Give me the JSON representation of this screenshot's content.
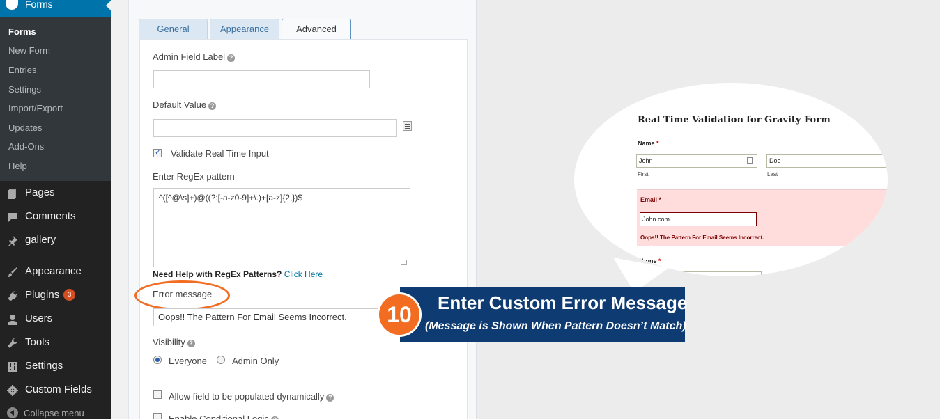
{
  "sidebar": {
    "top_label": "Forms",
    "submenu": [
      "Forms",
      "New Form",
      "Entries",
      "Settings",
      "Import/Export",
      "Updates",
      "Add-Ons",
      "Help"
    ],
    "items": [
      {
        "label": "Pages",
        "icon": "pages-icon"
      },
      {
        "label": "Comments",
        "icon": "comments-icon"
      },
      {
        "label": "gallery",
        "icon": "pin-icon"
      },
      {
        "label": "Appearance",
        "icon": "brush-icon"
      },
      {
        "label": "Plugins",
        "icon": "plugin-icon",
        "badge": "3"
      },
      {
        "label": "Users",
        "icon": "user-icon"
      },
      {
        "label": "Tools",
        "icon": "wrench-icon"
      },
      {
        "label": "Settings",
        "icon": "sliders-icon"
      },
      {
        "label": "Custom Fields",
        "icon": "gear-icon"
      }
    ],
    "collapse_label": "Collapse menu"
  },
  "tabs": [
    "General",
    "Appearance",
    "Advanced"
  ],
  "active_tab": "Advanced",
  "form": {
    "admin_label": "Admin Field Label",
    "admin_value": "",
    "default_label": "Default Value",
    "default_value": "",
    "validate_label": "Validate Real Time Input",
    "validate_checked": true,
    "regex_label": "Enter RegEx pattern",
    "regex_value": "^([^@\\s]+)@((?:[-a-z0-9]+\\.)+[a-z]{2,})$",
    "regex_help_text": "Need Help with RegEx Patterns?",
    "regex_help_link": "Click Here",
    "error_label": "Error message",
    "error_value": "Oops!! The Pattern For Email Seems Incorrect.",
    "visibility_label": "Visibility",
    "visibility_options": [
      "Everyone",
      "Admin Only"
    ],
    "visibility_selected": "Everyone",
    "allow_dynamic_label": "Allow field to be populated dynamically",
    "conditional_label": "Enable Conditional Logic"
  },
  "preview": {
    "title": "Real Time Validation for Gravity Form",
    "name_label": "Name",
    "first_value": "John",
    "first_sub": "First",
    "last_value": "Doe",
    "last_sub": "Last",
    "email_label": "Email",
    "email_value": "John.com",
    "error_text": "Oops!! The Pattern For Email Seems Incorrect.",
    "phone_label": "Phone",
    "required_mark": "*"
  },
  "callout": {
    "step": "10",
    "title": "Enter Custom Error Message",
    "subtitle": "(Message is Shown When Pattern Doesn’t Match)"
  },
  "colors": {
    "wp_blue": "#0073aa",
    "sidebar_dark": "#222222",
    "callout_navy": "#0e3c72",
    "accent_orange": "#f26c22",
    "error_pink": "#ffdddd"
  }
}
